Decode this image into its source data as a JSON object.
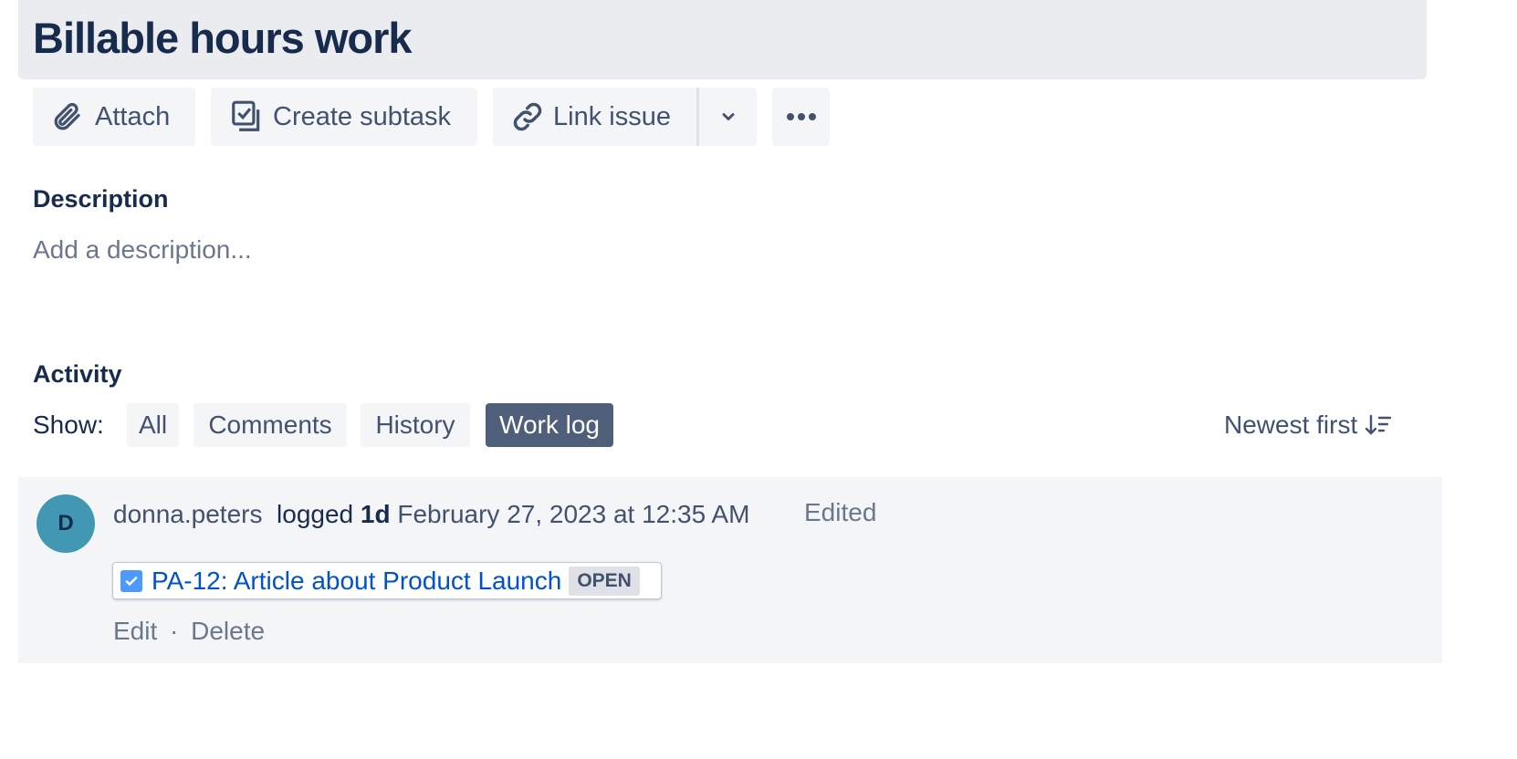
{
  "issue": {
    "title": "Billable hours work"
  },
  "toolbar": {
    "attach": "Attach",
    "create_subtask": "Create subtask",
    "link_issue": "Link issue"
  },
  "description": {
    "label": "Description",
    "placeholder": "Add a description..."
  },
  "activity": {
    "label": "Activity",
    "show_label": "Show:",
    "filters": [
      "All",
      "Comments",
      "History",
      "Work log"
    ],
    "active_filter": "Work log",
    "sort": "Newest first"
  },
  "worklog": {
    "avatar_initial": "D",
    "user": "donna.peters",
    "logged_label": "logged",
    "duration": "1d",
    "date": "February 27, 2023 at 12:35 AM",
    "edited": "Edited",
    "issue_link": "PA-12: Article about Product Launch",
    "status": "OPEN",
    "edit": "Edit",
    "separator": "·",
    "delete": "Delete"
  },
  "colors": {
    "avatar": "#4297b3",
    "active_filter": "#505f79",
    "link": "#0052cc"
  }
}
